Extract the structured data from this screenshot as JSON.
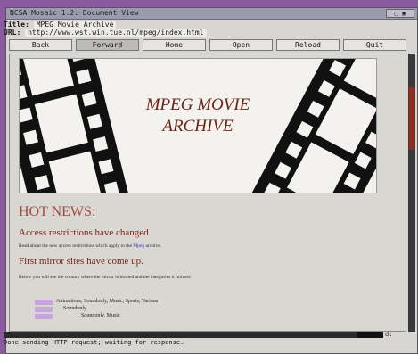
{
  "window": {
    "title": "NCSA Mosaic 1.2: Document View",
    "controls": "□ ▣"
  },
  "document": {
    "title_label": "Title:",
    "title_value": "MPEG Movie Archive",
    "url_label": "URL:",
    "url_value": "http://www.wst.win.tue.nl/mpeg/index.html"
  },
  "toolbar": {
    "back": "Back",
    "forward": "Forward",
    "home": "Home",
    "open": "Open",
    "reload": "Reload",
    "quit": "Quit"
  },
  "page": {
    "banner_title_line1": "MPEG MOVIE",
    "banner_title_line2": "ARCHIVE",
    "hot_news": "HOT NEWS:",
    "news1_heading": "Access restrictions have changed",
    "news1_text_before": "Read about the new access restrictions which apply to the",
    "news1_link": "Mpeg",
    "news1_text_after": "archive.",
    "news2_heading": "First mirror sites have come up.",
    "news2_text": "Below you will see the country where the mirror is located and the categories it mirrors:",
    "mirrors": [
      "Animations, Soundonly, Music, Sports, Various",
      "Soundonly",
      "Soundonly, Music"
    ]
  },
  "status": {
    "progress_fraction": 0.93,
    "progress_label": "d:",
    "message": "Done sending HTTP request; waiting for response."
  },
  "colors": {
    "banner_title": "#6b2418",
    "link": "#3a2bd0",
    "heading": "#a14a3e"
  }
}
